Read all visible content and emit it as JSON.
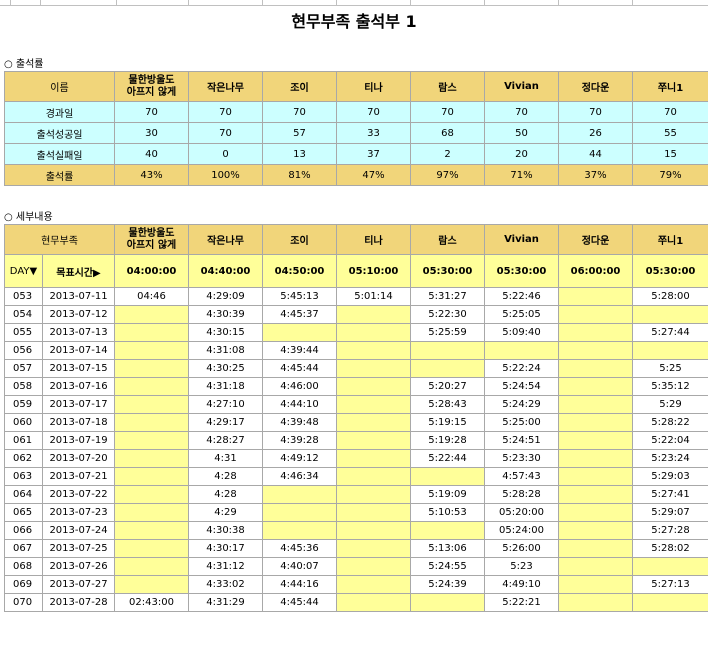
{
  "title": "현무부족 출석부 1",
  "section1": "○ 출석률",
  "section2": "○ 세부내용",
  "members": [
    "물한방울도\n아프지 않게",
    "작은나무",
    "조이",
    "티나",
    "람스",
    "Vivian",
    "정다운",
    "쭈니1"
  ],
  "summary": {
    "corner": "이름",
    "rows": [
      {
        "label": "경과일",
        "values": [
          "70",
          "70",
          "70",
          "70",
          "70",
          "70",
          "70",
          "70"
        ]
      },
      {
        "label": "출석성공일",
        "values": [
          "30",
          "70",
          "57",
          "33",
          "68",
          "50",
          "26",
          "55"
        ]
      },
      {
        "label": "출석실패일",
        "values": [
          "40",
          "0",
          "13",
          "37",
          "2",
          "20",
          "44",
          "15"
        ]
      },
      {
        "label": "출석률",
        "values": [
          "43%",
          "100%",
          "81%",
          "47%",
          "97%",
          "71%",
          "37%",
          "79%"
        ]
      }
    ]
  },
  "detail": {
    "corner": "현무부족",
    "day_label": "DAY▼",
    "target_label": "목표시간▶",
    "targets": [
      "04:00:00",
      "04:40:00",
      "04:50:00",
      "05:10:00",
      "05:30:00",
      "05:30:00",
      "06:00:00",
      "05:30:00"
    ],
    "rows": [
      {
        "day": "053",
        "date": "2013-07-11",
        "times": [
          "04:46",
          "4:29:09",
          "5:45:13",
          "5:01:14",
          "5:31:27",
          "5:22:46",
          "",
          "5:28:00"
        ]
      },
      {
        "day": "054",
        "date": "2013-07-12",
        "times": [
          "",
          "4:30:39",
          "4:45:37",
          "",
          "5:22:30",
          "5:25:05",
          "",
          ""
        ]
      },
      {
        "day": "055",
        "date": "2013-07-13",
        "times": [
          "",
          "4:30:15",
          "",
          "",
          "5:25:59",
          "5:09:40",
          "",
          "5:27:44"
        ]
      },
      {
        "day": "056",
        "date": "2013-07-14",
        "times": [
          "",
          "4:31:08",
          "4:39:44",
          "",
          "",
          "",
          "",
          ""
        ]
      },
      {
        "day": "057",
        "date": "2013-07-15",
        "times": [
          "",
          "4:30:25",
          "4:45:44",
          "",
          "",
          "5:22:24",
          "",
          "5:25"
        ]
      },
      {
        "day": "058",
        "date": "2013-07-16",
        "times": [
          "",
          "4:31:18",
          "4:46:00",
          "",
          "5:20:27",
          "5:24:54",
          "",
          "5:35:12"
        ]
      },
      {
        "day": "059",
        "date": "2013-07-17",
        "times": [
          "",
          "4:27:10",
          "4:44:10",
          "",
          "5:28:43",
          "5:24:29",
          "",
          "5:29"
        ]
      },
      {
        "day": "060",
        "date": "2013-07-18",
        "times": [
          "",
          "4:29:17",
          "4:39:48",
          "",
          "5:19:15",
          "5:25:00",
          "",
          "5:28:22"
        ]
      },
      {
        "day": "061",
        "date": "2013-07-19",
        "times": [
          "",
          "4:28:27",
          "4:39:28",
          "",
          "5:19:28",
          "5:24:51",
          "",
          "5:22:04"
        ]
      },
      {
        "day": "062",
        "date": "2013-07-20",
        "times": [
          "",
          "4:31",
          "4:49:12",
          "",
          "5:22:44",
          "5:23:30",
          "",
          "5:23:24"
        ]
      },
      {
        "day": "063",
        "date": "2013-07-21",
        "times": [
          "",
          "4:28",
          "4:46:34",
          "",
          "",
          "4:57:43",
          "",
          "5:29:03"
        ]
      },
      {
        "day": "064",
        "date": "2013-07-22",
        "times": [
          "",
          "4:28",
          "",
          "",
          "5:19:09",
          "5:28:28",
          "",
          "5:27:41"
        ]
      },
      {
        "day": "065",
        "date": "2013-07-23",
        "times": [
          "",
          "4:29",
          "",
          "",
          "5:10:53",
          "05:20:00",
          "",
          "5:29:07"
        ]
      },
      {
        "day": "066",
        "date": "2013-07-24",
        "times": [
          "",
          "4:30:38",
          "",
          "",
          "",
          "05:24:00",
          "",
          "5:27:28"
        ]
      },
      {
        "day": "067",
        "date": "2013-07-25",
        "times": [
          "",
          "4:30:17",
          "4:45:36",
          "",
          "5:13:06",
          "5:26:00",
          "",
          "5:28:02"
        ]
      },
      {
        "day": "068",
        "date": "2013-07-26",
        "times": [
          "",
          "4:31:12",
          "4:40:07",
          "",
          "5:24:55",
          "5:23",
          "",
          ""
        ]
      },
      {
        "day": "069",
        "date": "2013-07-27",
        "times": [
          "",
          "4:33:02",
          "4:44:16",
          "",
          "5:24:39",
          "4:49:10",
          "",
          "5:27:13"
        ]
      },
      {
        "day": "070",
        "date": "2013-07-28",
        "times": [
          "02:43:00",
          "4:31:29",
          "4:45:44",
          "",
          "",
          "5:22:21",
          "",
          ""
        ]
      }
    ]
  },
  "colors": {
    "header": "#f1d57a",
    "cyan": "#ccffff",
    "yellow": "#ffff99"
  }
}
